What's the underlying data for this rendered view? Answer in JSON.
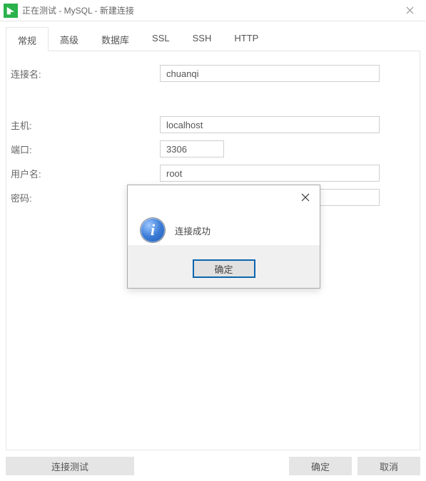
{
  "titlebar": {
    "title": "正在测试 - MySQL - 新建连接"
  },
  "tabs": {
    "general": "常规",
    "advanced": "高级",
    "database": "数据库",
    "ssl": "SSL",
    "ssh": "SSH",
    "http": "HTTP"
  },
  "form": {
    "conn_name_label": "连接名:",
    "conn_name_value": "chuanqi",
    "host_label": "主机:",
    "host_value": "localhost",
    "port_label": "端口:",
    "port_value": "3306",
    "user_label": "用户名:",
    "user_value": "root",
    "pwd_label": "密码:",
    "pwd_value": "••••••"
  },
  "buttons": {
    "test": "连接测试",
    "ok": "确定",
    "cancel": "取消"
  },
  "modal": {
    "message": "连接成功",
    "ok": "确定"
  }
}
